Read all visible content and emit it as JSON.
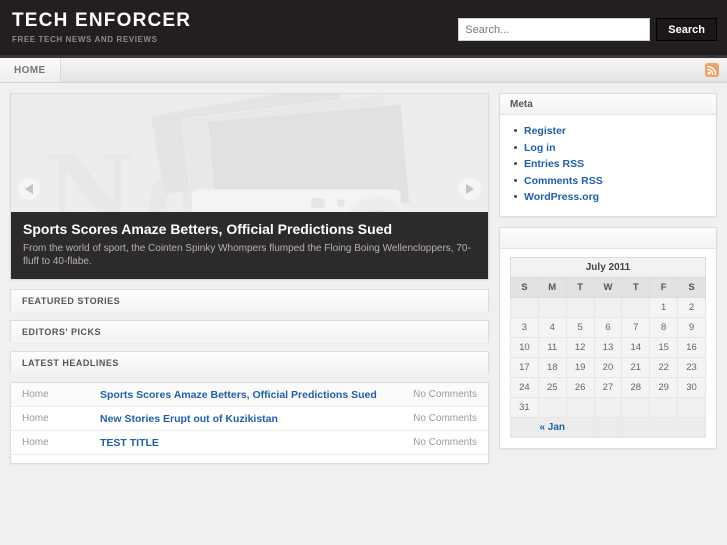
{
  "header": {
    "site_title": "TECH ENFORCER",
    "tagline": "FREE TECH NEWS AND REVIEWS",
    "search": {
      "placeholder": "Search...",
      "value": "",
      "button_label": "Search"
    }
  },
  "nav": {
    "items": [
      {
        "label": "HOME"
      }
    ],
    "rss_icon": "rss-icon"
  },
  "slider": {
    "prev_icon": "arrow-left-icon",
    "next_icon": "arrow-right-icon",
    "slide": {
      "title": "Sports Scores Amaze Betters, Official Predictions Sued",
      "excerpt": "From the world of sport, the Cointen Spinky Whompers flumped the Floing Boing Wellencloppers, 70-fluff to 40-flabe."
    }
  },
  "panels": [
    {
      "title": "FEATURED STORIES"
    },
    {
      "title": "EDITORS' PICKS"
    },
    {
      "title": "LATEST HEADLINES"
    }
  ],
  "headlines": [
    {
      "category": "Home",
      "title": "Sports Scores Amaze Betters, Official Predictions Sued",
      "comments": "No Comments"
    },
    {
      "category": "Home",
      "title": "New Stories Erupt out of Kuzikistan",
      "comments": "No Comments"
    },
    {
      "category": "Home",
      "title": "TEST TITLE",
      "comments": "No Comments"
    }
  ],
  "sidebar": {
    "meta_widget": {
      "title": "Meta",
      "links": [
        {
          "label": "Register"
        },
        {
          "label": "Log in"
        },
        {
          "label": "Entries RSS"
        },
        {
          "label": "Comments RSS"
        },
        {
          "label": "WordPress.org"
        }
      ]
    },
    "calendar_widget": {
      "title": "",
      "caption": "July 2011",
      "weekdays": [
        "S",
        "M",
        "T",
        "W",
        "T",
        "F",
        "S"
      ],
      "weeks": [
        [
          "",
          "",
          "",
          "",
          "",
          "1",
          "2"
        ],
        [
          "3",
          "4",
          "5",
          "6",
          "7",
          "8",
          "9"
        ],
        [
          "10",
          "11",
          "12",
          "13",
          "14",
          "15",
          "16"
        ],
        [
          "17",
          "18",
          "19",
          "20",
          "21",
          "22",
          "23"
        ],
        [
          "24",
          "25",
          "26",
          "27",
          "28",
          "29",
          "30"
        ],
        [
          "31",
          "",
          "",
          "",
          "",
          "",
          ""
        ]
      ],
      "prev_label": "« Jan",
      "next_label": ""
    }
  },
  "colors": {
    "header_bg": "#231f20",
    "page_bg": "#f0f0f0",
    "link": "#1f5fa9",
    "rss_orange": "#eda26a",
    "caption_bg": "#2d2a2b"
  }
}
